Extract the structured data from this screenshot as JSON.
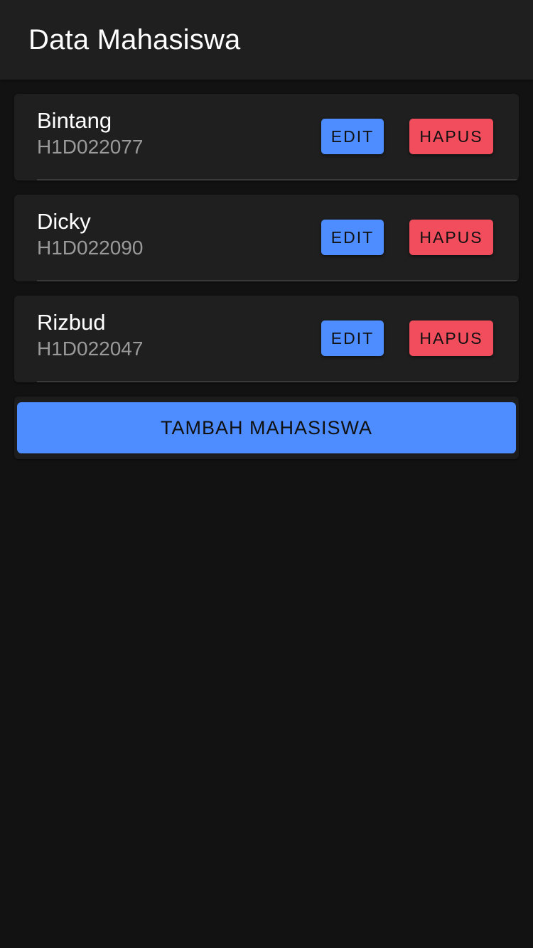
{
  "app_bar": {
    "title": "Data Mahasiswa"
  },
  "students": [
    {
      "name": "Bintang",
      "nim": "H1D022077",
      "edit_label": "EDIT",
      "delete_label": "HAPUS"
    },
    {
      "name": "Dicky",
      "nim": "H1D022090",
      "edit_label": "EDIT",
      "delete_label": "HAPUS"
    },
    {
      "name": "Rizbud",
      "nim": "H1D022047",
      "edit_label": "EDIT",
      "delete_label": "HAPUS"
    }
  ],
  "add_button": {
    "label": "TAMBAH MAHASISWA"
  },
  "colors": {
    "background": "#121212",
    "app_bar": "#1f1f1f",
    "card": "#1f1f1f",
    "edit": "#4d8dff",
    "delete": "#f24d5c",
    "add": "#4d8dff",
    "nim_text": "#9a9a9a"
  }
}
